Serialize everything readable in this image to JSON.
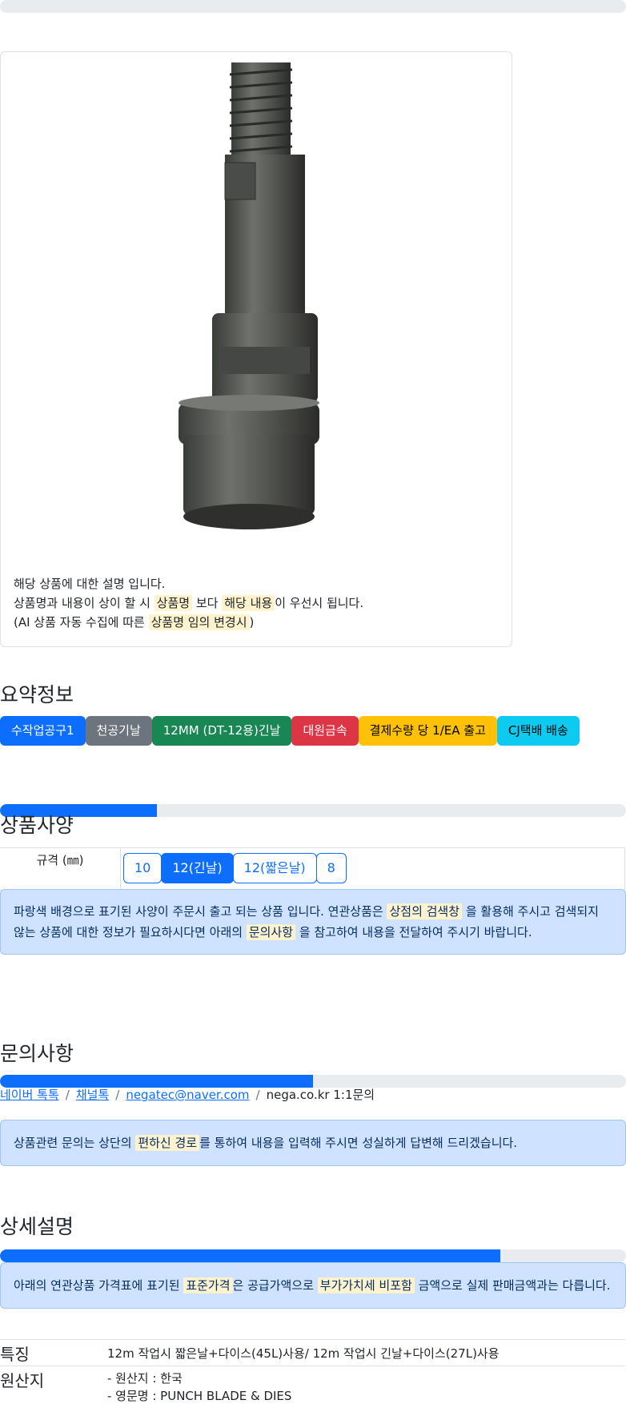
{
  "card": {
    "line1": "해당 상품에 대한 설명 입니다.",
    "line2_pre": "상품명과 내용이 상이 할 시",
    "line2_hl1": "상품명",
    "line2_mid": "보다",
    "line2_hl2": "해당 내용",
    "line2_post": "이 우선시 됩니다.",
    "line3_pre": "(AI 상품 자동 수집에 따른",
    "line3_hl": "상품명 임의 변경시",
    "line3_post": ")"
  },
  "summary": {
    "title": "요약정보",
    "badges": [
      "수작업공구1",
      "천공기날",
      "12MM (DT-12용)긴날",
      "대원금속",
      "결제수량 당 1/EA 출고",
      "CJ택배 배송"
    ]
  },
  "spec": {
    "title": "상품사양",
    "label": "규격 (㎜)",
    "options": [
      "10",
      "12(긴날)",
      "12(짧은날)",
      "8"
    ],
    "selected": "12(긴날)",
    "notice_p1": "파랑색 배경으로 표기된 사양이 주문시 출고 되는 상품 입니다. 연관상품은",
    "notice_hl1": "상점의 검색창",
    "notice_p2": "을 활용해 주시고 검색되지 않는 상품에 대한 정보가 필요하시다면 아래의",
    "notice_hl2": "문의사항",
    "notice_p3": "을 참고하여 내용을 전달하여 주시기 바랍니다."
  },
  "inquiry": {
    "title": "문의사항",
    "links": [
      "네이버 톡톡",
      "채널톡",
      "negatec@naver.com"
    ],
    "plain": "nega.co.kr 1:1문의",
    "notice_p1": "상품관련 문의는 상단의",
    "notice_hl": "편하신 경로",
    "notice_p2": "를 통하여 내용을 입력해 주시면 성실하게 답변해 드리겠습니다."
  },
  "detail": {
    "title": "상세설명",
    "notice_p1": "아래의 연관상품 가격표에 표기된",
    "notice_hl1": "표준가격",
    "notice_p2": "은 공급가액으로",
    "notice_hl2": "부가가치세 비포함",
    "notice_p3": "금액으로 실제 판매금액과는 다릅니다.",
    "rows": [
      {
        "key": "특징",
        "value": "12m 작업시 짧은날+다이스(45L)사용/ 12m 작업시 긴날+다이스(27L)사용"
      },
      {
        "key": "원산지",
        "value1": "- 원산지 : 한국",
        "value2": "- 영문명 : PUNCH BLADE & DIES"
      }
    ]
  },
  "progress": {
    "top": 0,
    "spec": 25,
    "inquiry": 50,
    "detail": 80
  },
  "colors": {
    "primary": "#0d6efd",
    "highlight": "#fff3cd",
    "alert_bg": "#cfe2ff"
  }
}
